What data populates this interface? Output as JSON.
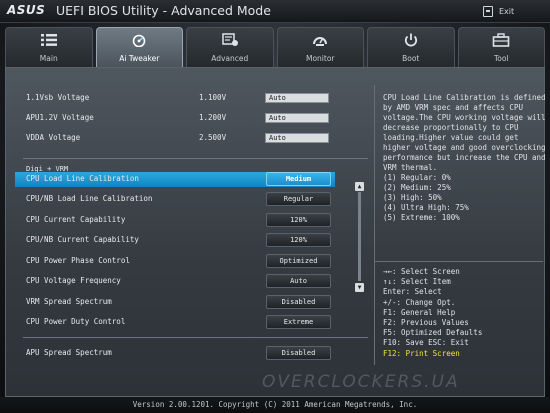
{
  "titlebar": {
    "brand": "ASUS",
    "title": "UEFI BIOS Utility - Advanced Mode",
    "exit_label": "Exit"
  },
  "tabs": [
    {
      "label": "Main",
      "icon": "list-icon"
    },
    {
      "label": "Ai Tweaker",
      "icon": "speedometer-icon"
    },
    {
      "label": "Advanced",
      "icon": "advanced-settings-icon"
    },
    {
      "label": "Monitor",
      "icon": "gauge-icon"
    },
    {
      "label": "Boot",
      "icon": "power-icon"
    },
    {
      "label": "Tool",
      "icon": "toolbox-icon"
    }
  ],
  "active_tab": "Ai Tweaker",
  "voltages": [
    {
      "label": "1.1Vsb Voltage",
      "current": "1.100V",
      "value": "Auto"
    },
    {
      "label": "APU1.2V Voltage",
      "current": "1.200V",
      "value": "Auto"
    },
    {
      "label": "VDDA Voltage",
      "current": "2.500V",
      "value": "Auto"
    }
  ],
  "section_title": "Digi + VRM",
  "digi": [
    {
      "label": "CPU Load Line Calibration",
      "value": "Medium",
      "selected": true
    },
    {
      "label": "CPU/NB Load Line Calibration",
      "value": "Regular"
    },
    {
      "label": "CPU Current Capability",
      "value": "120%"
    },
    {
      "label": "CPU/NB Current Capability",
      "value": "120%"
    },
    {
      "label": "CPU Power Phase Control",
      "value": "Optimized"
    },
    {
      "label": "CPU Voltage Frequency",
      "value": "Auto"
    },
    {
      "label": "VRM Spread Spectrum",
      "value": "Disabled"
    },
    {
      "label": "CPU Power Duty Control",
      "value": "Extreme"
    }
  ],
  "apu_spread": {
    "label": "APU Spread Spectrum",
    "value": "Disabled"
  },
  "help_lines": [
    "CPU Load Line Calibration is defined",
    "by AMD VRM spec and affects CPU",
    "voltage.The CPU working voltage will",
    "decrease proportionally to CPU",
    "loading.Higher value could get",
    "higher voltage and good overclocking",
    "performance but increase the CPU and",
    "VRM thermal.",
    "(1) Regular: 0%",
    "(2) Medium: 25%",
    "(3) High: 50%",
    "(4) Ultra High: 75%",
    "(5) Extreme: 100%"
  ],
  "keys": [
    "→←: Select Screen",
    "↑↓: Select Item",
    "Enter: Select",
    "+/-: Change Opt.",
    "F1: General Help",
    "F2: Previous Values",
    "F5: Optimized Defaults",
    "F10: Save  ESC: Exit"
  ],
  "key_highlight": "F12: Print Screen",
  "watermark": "OVERCLOCKERS.UA",
  "footer": "Version 2.00.1201. Copyright (C) 2011 American Megatrends, Inc.",
  "colors": {
    "selection": "#1f98d3",
    "highlight_key": "#f2e23b"
  }
}
